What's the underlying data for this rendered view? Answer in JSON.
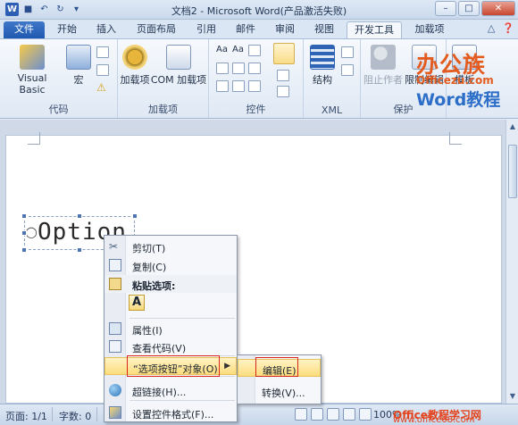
{
  "window": {
    "title": "文档2 - Microsoft Word(产品激活失败)",
    "qat_icons": [
      "word-icon",
      "save-icon",
      "undo-icon",
      "redo-icon",
      "customize-icon"
    ]
  },
  "tabs": [
    {
      "label": "文件"
    },
    {
      "label": "开始"
    },
    {
      "label": "插入"
    },
    {
      "label": "页面布局"
    },
    {
      "label": "引用"
    },
    {
      "label": "邮件"
    },
    {
      "label": "审阅"
    },
    {
      "label": "视图"
    },
    {
      "label": "开发工具"
    },
    {
      "label": "加载项"
    }
  ],
  "ribbon": {
    "code": {
      "vba": "Visual Basic",
      "macro": "宏",
      "label": "代码"
    },
    "addins": {
      "addin": "加载项",
      "com": "COM 加载项",
      "label": "加载项"
    },
    "controls": {
      "label": "控件"
    },
    "xml": {
      "structure": "结构",
      "label": "XML"
    },
    "protect": {
      "block_authors": "阻止作者",
      "restrict": "限制编辑",
      "label": "保护"
    },
    "templates": {
      "template": "模板"
    }
  },
  "brand": {
    "line1": "办公族",
    "line2": "Officezu.com",
    "line3": "Word教程"
  },
  "document": {
    "option_label": "Option"
  },
  "context_menu": {
    "cut": "剪切(T)",
    "copy": "复制(C)",
    "paste_options": "粘贴选项:",
    "paste_a": "A",
    "properties": "属性(I)",
    "view_code": "查看代码(V)",
    "radio_object": "“选项按钮”对象(O)",
    "hyperlink": "超链接(H)...",
    "format_control": "设置控件格式(F)..."
  },
  "submenu": {
    "edit": "编辑(E)",
    "convert": "转换(V)..."
  },
  "statusbar": {
    "page": "页面: 1/1",
    "words": "字数: 0",
    "zoom": "100%",
    "watermark1": "Office教程学习网",
    "watermark2": "www.office68.com"
  },
  "colors": {
    "file_tab": "#2c5fb3",
    "highlight": "#fcdd7d",
    "annotation_red": "#d8261c"
  }
}
